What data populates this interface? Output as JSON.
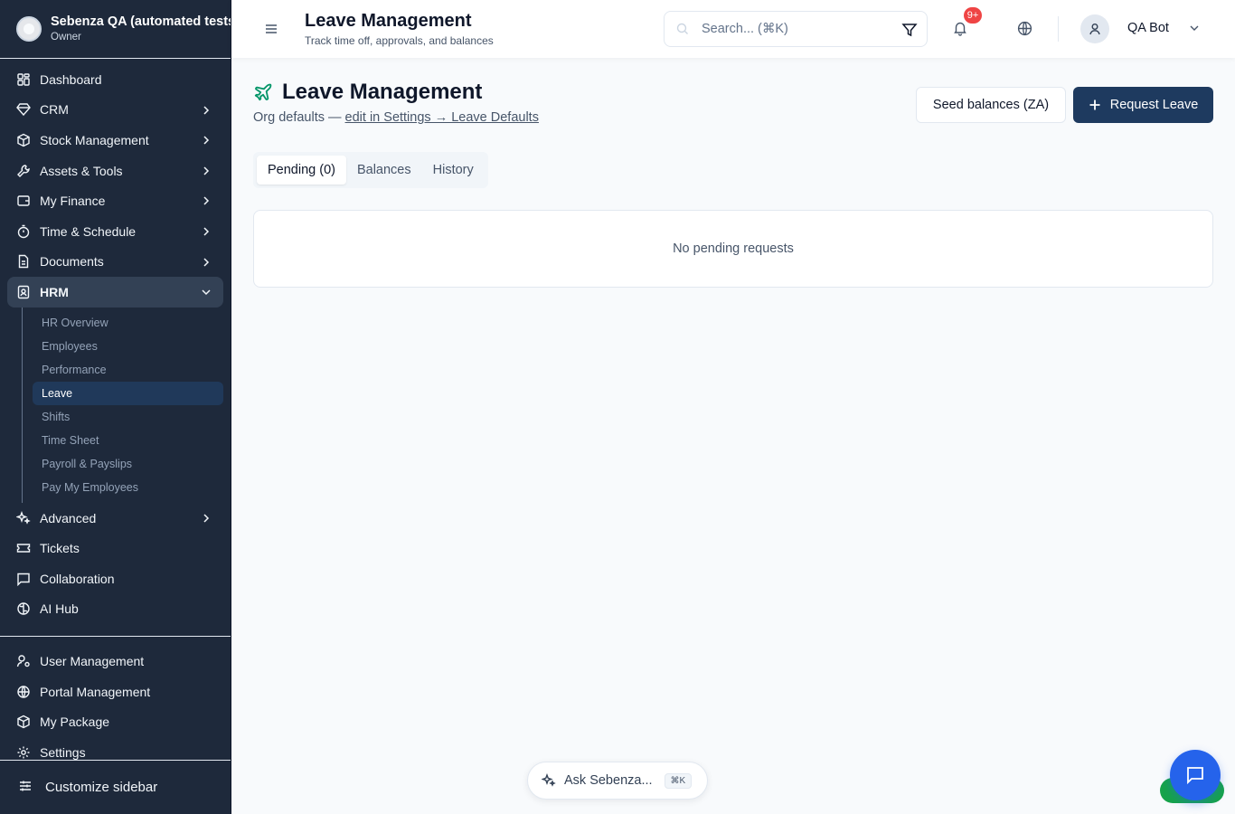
{
  "org": {
    "name": "Sebenza QA (automated tests)",
    "role": "Owner"
  },
  "nav": {
    "dashboard": "Dashboard",
    "crm": "CRM",
    "stock": "Stock Management",
    "assets": "Assets & Tools",
    "finance": "My Finance",
    "time": "Time & Schedule",
    "documents": "Documents",
    "hrm": "HRM",
    "hrm_sub": [
      "HR Overview",
      "Employees",
      "Performance",
      "Leave",
      "Shifts",
      "Time Sheet",
      "Payroll & Payslips",
      "Pay My Employees"
    ],
    "advanced": "Advanced",
    "tickets": "Tickets",
    "collaboration": "Collaboration",
    "ai_hub": "AI Hub",
    "user_mgmt": "User Management",
    "portal_mgmt": "Portal Management",
    "my_package": "My Package",
    "settings": "Settings",
    "customize": "Customize sidebar"
  },
  "topbar": {
    "title": "Leave Management",
    "subtitle": "Track time off, approvals, and balances",
    "search_placeholder": "Search... (⌘K)",
    "notif_count": "9+",
    "user_name": "QA Bot"
  },
  "page": {
    "title": "Leave Management",
    "org_defaults_prefix": "Org defaults —",
    "org_defaults_link": "edit in Settings → Leave Defaults",
    "seed_button": "Seed balances (ZA)",
    "request_button": "Request Leave",
    "tabs": [
      "Pending (0)",
      "Balances",
      "History"
    ],
    "empty_message": "No pending requests"
  },
  "assistant": {
    "label": "Ask Sebenza...",
    "shortcut": "⌘K"
  },
  "colors": {
    "sidebar_bg": "#1e293b",
    "primary": "#1e3a5f",
    "accent_green": "#16a34a",
    "chat_blue": "#2563eb",
    "badge_red": "#ef4444"
  }
}
